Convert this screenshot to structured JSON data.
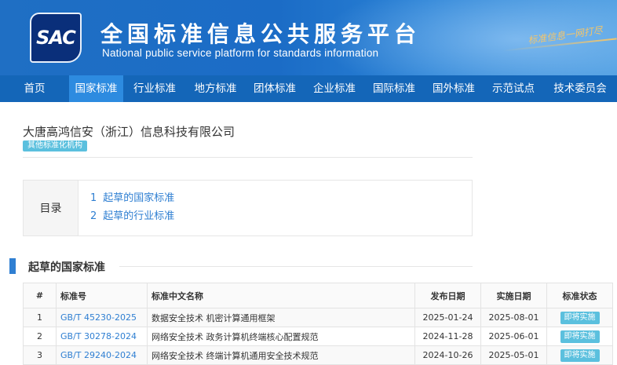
{
  "header": {
    "logo_text": "SAC",
    "title": "全国标准信息公共服务平台",
    "subtitle": "National public service platform  for standards information",
    "slogan": "标准信息一网打尽"
  },
  "nav": {
    "items": [
      "首页",
      "国家标准",
      "行业标准",
      "地方标准",
      "团体标准",
      "企业标准",
      "国际标准",
      "国外标准",
      "示范试点",
      "技术委员会"
    ],
    "active_index": 1
  },
  "org": {
    "name": "大唐高鸿信安（浙江）信息科技有限公司",
    "badge": "其他标准化机构"
  },
  "toc": {
    "title": "目录",
    "links": [
      {
        "num": "1",
        "label": "起草的国家标准"
      },
      {
        "num": "2",
        "label": "起草的行业标准"
      }
    ]
  },
  "section": {
    "title": "起草的国家标准"
  },
  "table": {
    "headers": [
      "#",
      "标准号",
      "标准中文名称",
      "发布日期",
      "实施日期",
      "标准状态"
    ],
    "rows": [
      {
        "idx": "1",
        "code": "GB/T 45230-2025",
        "name": "数据安全技术 机密计算通用框架",
        "release": "2025-01-24",
        "effective": "2025-08-01",
        "status": "即将实施"
      },
      {
        "idx": "2",
        "code": "GB/T 30278-2024",
        "name": "网络安全技术 政务计算机终端核心配置规范",
        "release": "2024-11-28",
        "effective": "2025-06-01",
        "status": "即将实施"
      },
      {
        "idx": "3",
        "code": "GB/T 29240-2024",
        "name": "网络安全技术 终端计算机通用安全技术规范",
        "release": "2024-10-26",
        "effective": "2025-05-01",
        "status": "即将实施"
      }
    ]
  },
  "colors": {
    "nav_bg": "#1466b8",
    "nav_active": "#2d8be0",
    "link": "#2f7fd2",
    "badge": "#5bc0de"
  }
}
